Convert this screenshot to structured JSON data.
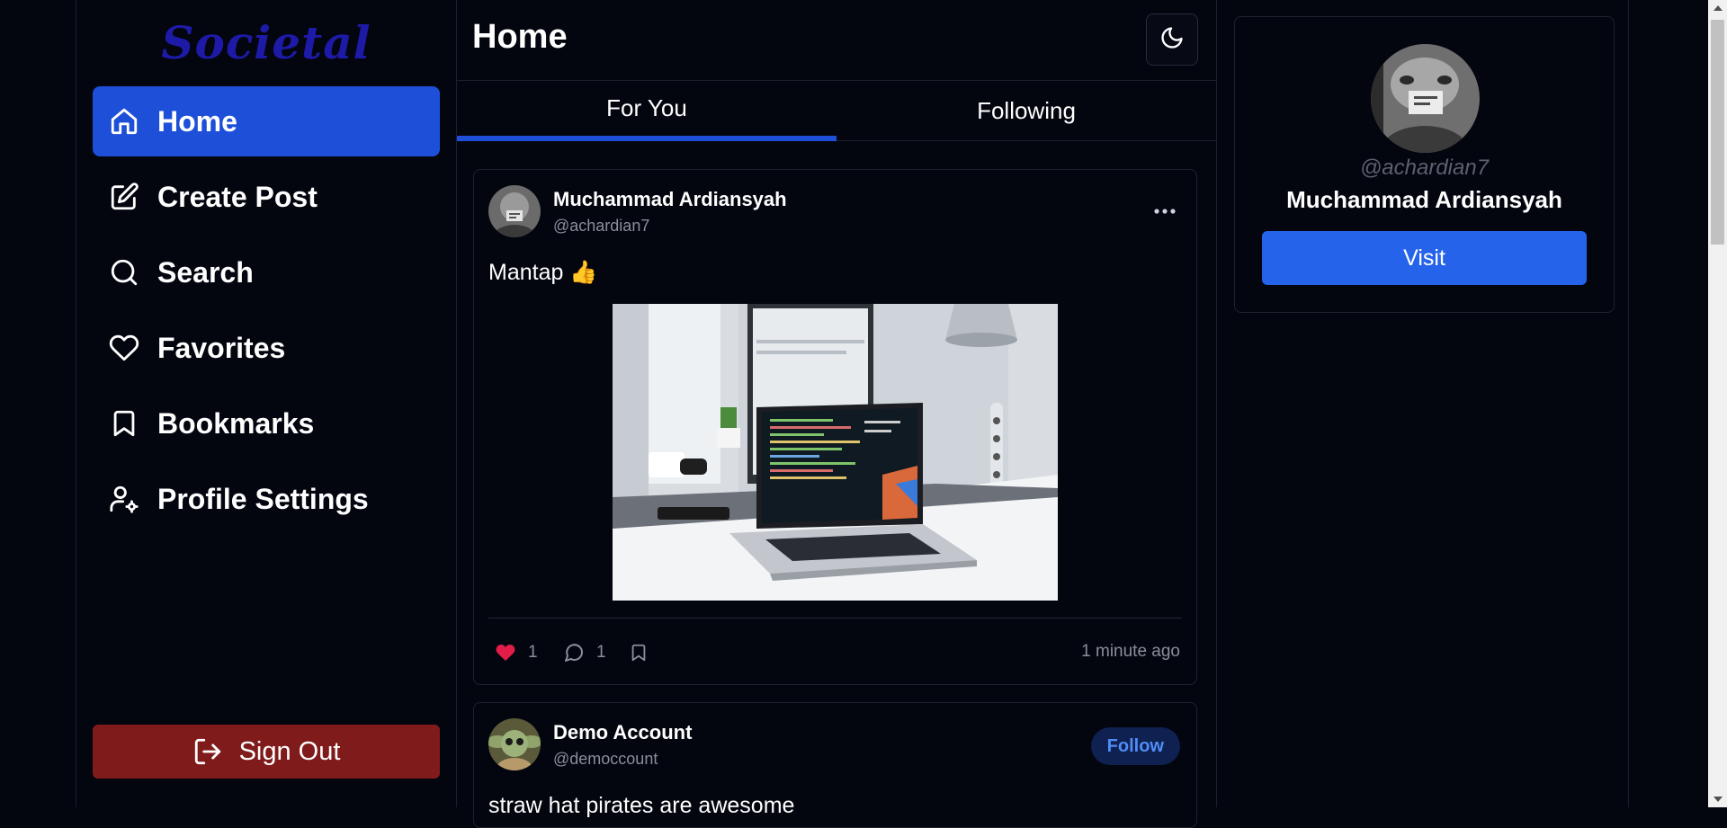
{
  "app": {
    "name": "Societal"
  },
  "sidebar": {
    "items": [
      {
        "label": "Home",
        "icon": "home-icon",
        "active": true
      },
      {
        "label": "Create Post",
        "icon": "edit-icon",
        "active": false
      },
      {
        "label": "Search",
        "icon": "search-icon",
        "active": false
      },
      {
        "label": "Favorites",
        "icon": "heart-icon",
        "active": false
      },
      {
        "label": "Bookmarks",
        "icon": "bookmark-icon",
        "active": false
      },
      {
        "label": "Profile Settings",
        "icon": "user-cog-icon",
        "active": false
      }
    ],
    "sign_out_label": "Sign Out"
  },
  "header": {
    "title": "Home",
    "theme_toggle_icon": "moon-icon"
  },
  "tabs": [
    {
      "label": "For You",
      "active": true
    },
    {
      "label": "Following",
      "active": false
    }
  ],
  "posts": [
    {
      "author_name": "Muchammad Ardiansyah",
      "author_handle": "@achardian7",
      "text": "Mantap 👍",
      "likes": "1",
      "liked": true,
      "comments": "1",
      "timestamp": "1 minute ago"
    },
    {
      "author_name": "Demo Account",
      "author_handle": "@democcount",
      "follow_label": "Follow",
      "text": "straw hat pirates are awesome"
    }
  ],
  "profile_card": {
    "handle": "@achardian7",
    "name": "Muchammad Ardiansyah",
    "visit_label": "Visit"
  },
  "colors": {
    "background": "#03050f",
    "accent": "#1d4fd8",
    "visit_button": "#2563eb",
    "sign_out": "#801b1b",
    "like": "#e11d48",
    "follow_text": "#4f8df5"
  }
}
